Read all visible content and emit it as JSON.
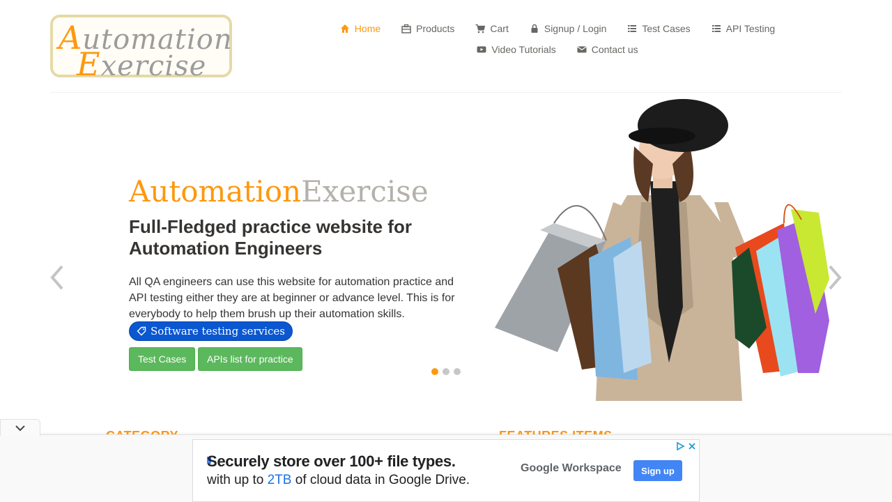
{
  "logo": {
    "line1_cap": "A",
    "line1_rest": "utomation",
    "line2_cap": "E",
    "line2_rest": "xercise"
  },
  "nav": [
    {
      "label": "Home",
      "icon": "home-icon",
      "active": true
    },
    {
      "label": "Products",
      "icon": "products-icon"
    },
    {
      "label": "Cart",
      "icon": "cart-icon"
    },
    {
      "label": "Signup / Login",
      "icon": "lock-icon"
    },
    {
      "label": "Test Cases",
      "icon": "list-icon"
    },
    {
      "label": "API Testing",
      "icon": "list-icon"
    },
    {
      "label": "Video Tutorials",
      "icon": "youtube-icon"
    },
    {
      "label": "Contact us",
      "icon": "envelope-icon"
    }
  ],
  "slider": {
    "brand_a": "Automation",
    "brand_b": "Exercise",
    "headline": "Full-Fledged practice website for Automation Engineers",
    "description": "All QA engineers can use this website for automation practice and API testing either they are at beginner or advance level. This is for everybody to help them brush up their automation skills.",
    "pill": "Software testing services",
    "btn_test_cases": "Test Cases",
    "btn_apis": "APIs list for practice",
    "active_slide": 1,
    "slide_count": 3
  },
  "sections": {
    "category": "CATEGORY",
    "features": "FEATURES ITEMS"
  },
  "ad": {
    "title": "Securely store over 100+ file types.",
    "sub_before": "with up to ",
    "sub_highlight": "2TB",
    "sub_after": " of cloud data in Google Drive.",
    "brand_google": "Google",
    "brand_product": " Workspace",
    "signup": "Sign up"
  },
  "colors": {
    "accent": "#fe980f",
    "green": "#5cb85c",
    "pill_blue": "#0b57d0",
    "ad_blue": "#4285f4"
  }
}
